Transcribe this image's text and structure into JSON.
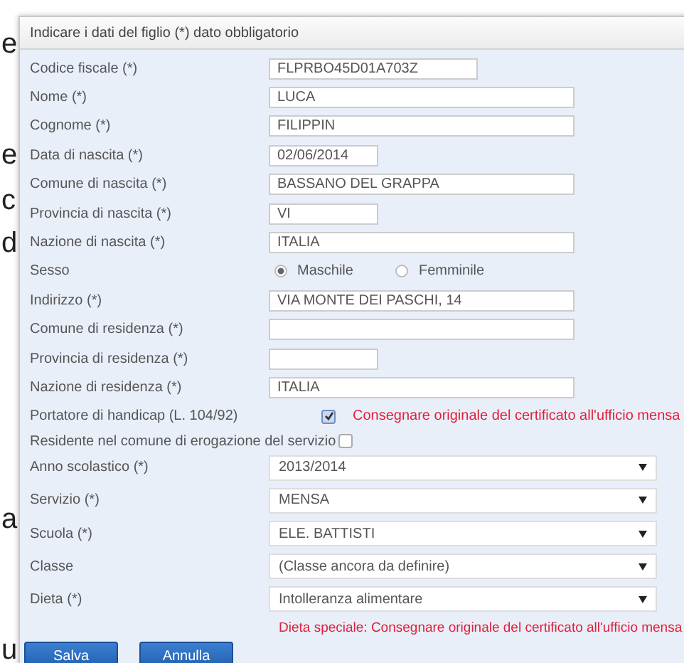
{
  "background_text": [
    "e",
    "e",
    "c",
    "d",
    "a",
    "u"
  ],
  "dialog": {
    "title": "Indicare i dati del figlio (*) dato obbligatorio",
    "fields": [
      {
        "kind": "text",
        "label": "Codice fiscale (*)",
        "value": "FLPRBO45D01A703Z"
      },
      {
        "kind": "text",
        "label": "Nome (*)",
        "value": "LUCA"
      },
      {
        "kind": "text",
        "label": "Cognome (*)",
        "value": "FILIPPIN"
      },
      {
        "kind": "text",
        "label": "Data di nascita (*)",
        "value": "02/06/2014"
      },
      {
        "kind": "text",
        "label": "Comune di nascita (*)",
        "value": "BASSANO DEL GRAPPA"
      },
      {
        "kind": "text",
        "label": "Provincia di nascita (*)",
        "value": "VI"
      },
      {
        "kind": "text",
        "label": "Nazione di nascita (*)",
        "value": "ITALIA"
      },
      {
        "kind": "radio",
        "label": "Sesso",
        "options": [
          {
            "label": "Maschile",
            "selected": true
          },
          {
            "label": "Femminile",
            "selected": false
          }
        ]
      },
      {
        "kind": "text",
        "label": "Indirizzo (*)",
        "value": "VIA MONTE DEI PASCHI, 14"
      },
      {
        "kind": "text",
        "label": "Comune di residenza (*)"
      },
      {
        "kind": "text",
        "label": "Provincia di residenza (*)"
      },
      {
        "kind": "text",
        "label": "Nazione di residenza (*)",
        "value": "ITALIA"
      },
      {
        "kind": "checkbox",
        "label": "Portatore di handicap (L. 104/92)",
        "checked": true,
        "note": "Consegnare originale del certificato all'ufficio mensa"
      },
      {
        "kind": "inline_checkbox",
        "label": "Residente nel comune di erogazione del servizio",
        "checked": false
      },
      {
        "kind": "select",
        "label": "Anno scolastico (*)",
        "value": "2013/2014"
      },
      {
        "kind": "select",
        "label": "Servizio (*)",
        "value": "MENSA"
      },
      {
        "kind": "select",
        "label": "Scuola (*)",
        "value": "ELE. BATTISTI"
      },
      {
        "kind": "select",
        "label": "Classe",
        "value": "(Classe ancora da definire)"
      },
      {
        "kind": "select",
        "label": "Dieta (*)",
        "value": "Intolleranza alimentare"
      }
    ],
    "diet_note": "Dieta speciale: Consegnare originale del certificato all'ufficio mensa",
    "buttons": [
      "Salva",
      "Annulla"
    ]
  }
}
